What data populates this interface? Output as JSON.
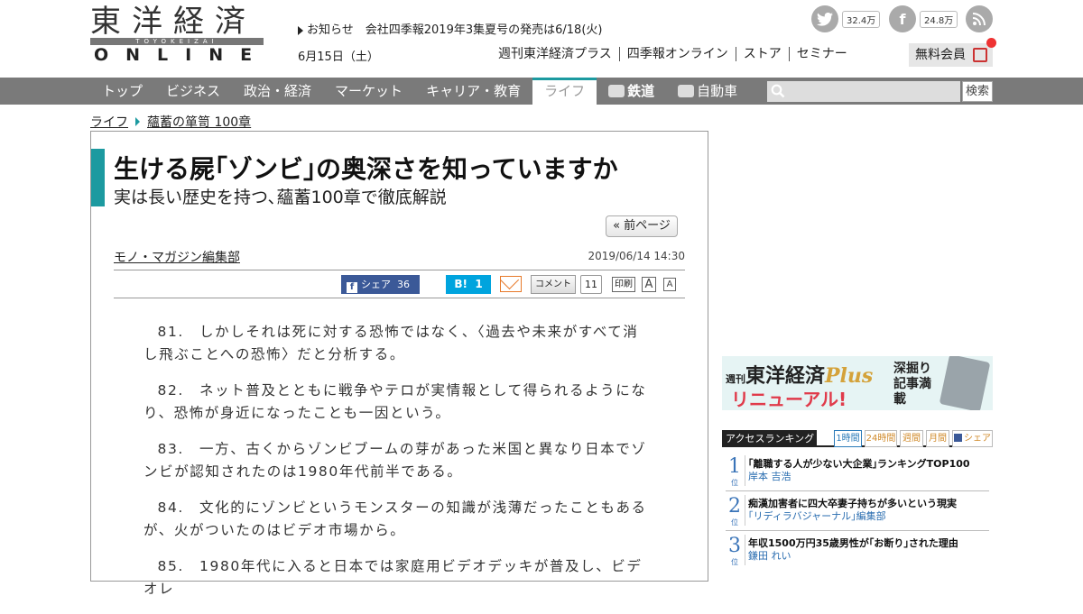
{
  "header": {
    "logo_jp": "東洋経済",
    "logo_roman": "TOYOKEIZAI",
    "logo_online": "ONLINE",
    "notice_label": "お知らせ",
    "notice_text": "会社四季報2019年3集夏号の発売は6/18(火)",
    "date": "6月15日（土）",
    "twitter_count": "32.4万",
    "facebook_count": "24.8万",
    "top_links": [
      "週刊東洋経済プラス",
      "四季報オンライン",
      "ストア",
      "セミナー"
    ],
    "member_label": "無料会員"
  },
  "nav": {
    "items": [
      "トップ",
      "ビジネス",
      "政治・経済",
      "マーケット",
      "キャリア・教育",
      "ライフ",
      "鉄道",
      "自動車"
    ],
    "search_button": "検索"
  },
  "breadcrumb": {
    "section": "ライフ",
    "series": "蘊蓄の箪笥 100章"
  },
  "article": {
    "title": "生ける屍｢ゾンビ｣の奥深さを知っていますか",
    "subtitle": "実は長い歴史を持つ､蘊蓄100章で徹底解説",
    "prev_page": "« 前ページ",
    "author": "モノ・マガジン編集部",
    "date": "2019/06/14 14:30",
    "fb_share_label": "シェア",
    "fb_share_count": "36",
    "hatena_label": "B!",
    "hatena_count": "1",
    "comment_label": "コメント",
    "comment_count": "11",
    "print_label": "印刷",
    "font_big": "A",
    "font_small": "A",
    "paragraphs": [
      "81.　しかしそれは死に対する恐怖ではなく、〈過去や未来がすべて消し飛ぶことへの恐怖〉だと分析する。",
      "82.　ネット普及とともに戦争やテロが実情報として得られるようになり、恐怖が身近になったことも一因という。",
      "83.　一方、古くからゾンビブームの芽があった米国と異なり日本でゾンビが認知されたのは1980年代前半である。",
      "84.　文化的にゾンビというモンスターの知識が浅薄だったこともあるが、火がついたのはビデオ市場から。",
      "85.　1980年代に入ると日本では家庭用ビデオデッキが普及し、ビデオレ"
    ]
  },
  "sidebar": {
    "banner": {
      "line1": "東洋経済",
      "line1_plus": "Plus",
      "weekly": "週刊",
      "line2": "リニューアル!",
      "line3": "深掘り記事満載"
    },
    "ranking": {
      "title": "アクセスランキング",
      "tabs": [
        "1時間",
        "24時間",
        "週間",
        "月間",
        "シェア"
      ],
      "items": [
        {
          "num": "1",
          "pos": "位",
          "title": "｢離職する人が少ない大企業｣ランキングTOP100",
          "author": "岸本 吉浩"
        },
        {
          "num": "2",
          "pos": "位",
          "title": "痴漢加害者に四大卒妻子持ちが多いという現実",
          "author": "｢リディラバジャーナル｣編集部"
        },
        {
          "num": "3",
          "pos": "位",
          "title": "年収1500万円35歳男性が｢お断り｣された理由",
          "author": "鎌田 れい"
        }
      ]
    }
  }
}
